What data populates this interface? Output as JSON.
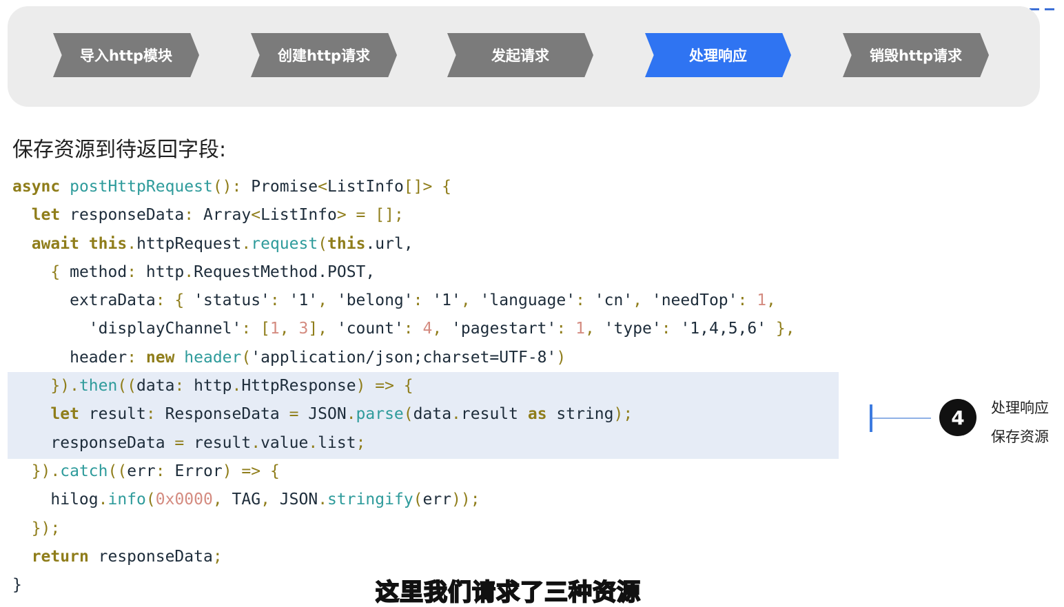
{
  "steps": [
    {
      "label": "导入http模块",
      "active": false
    },
    {
      "label": "创建http请求",
      "active": false
    },
    {
      "label": "发起请求",
      "active": false
    },
    {
      "label": "处理响应",
      "active": true
    },
    {
      "label": "销毁http请求",
      "active": false
    }
  ],
  "section_title": "保存资源到待返回字段:",
  "code": {
    "line1": {
      "kw": "async",
      "fn": "postHttpRequest",
      "a": "(): ",
      "b": "Promise",
      "c": "<",
      "d": "ListInfo",
      "e": "[]> {"
    },
    "line2": {
      "kw": "let",
      "a": " responseData",
      "b": ": ",
      "c": "Array",
      "d": "<",
      "e": "ListInfo",
      "f": "> = [];"
    },
    "line3": {
      "kw1": "await",
      "kw2": "this",
      "a": ".",
      "b": "httpRequest",
      "c": ".",
      "fn": "request",
      "d": "(",
      "kw3": "this",
      "e": ".url,"
    },
    "line4": {
      "a": "{ ",
      "b": "method",
      "c": ": ",
      "d": "http",
      "e": ".",
      "f": "RequestMethod",
      "g": ".POST,"
    },
    "line5": {
      "a": "extraData",
      "b": ": { ",
      "c": "'status'",
      "d": ": ",
      "e": "'1'",
      "f": ", ",
      "g": "'belong'",
      "h": ": ",
      "i": "'1'",
      "j": ", ",
      "k": "'language'",
      "l": ": ",
      "m": "'cn'",
      "n": ", ",
      "o": "'needTop'",
      "p": ": ",
      "q": "1",
      "r": ","
    },
    "line6": {
      "a": "'displayChannel'",
      "b": ": [",
      "c": "1",
      "d": ", ",
      "e": "3",
      "f": "], ",
      "g": "'count'",
      "h": ": ",
      "i": "4",
      "j": ", ",
      "k": "'pagestart'",
      "l": ": ",
      "m": "1",
      "n": ", ",
      "o": "'type'",
      "p": ": ",
      "q": "'1,4,5,6'",
      "r": " },"
    },
    "line7": {
      "a": "header",
      "b": ": ",
      "kw": "new",
      "fn": "header",
      "c": "(",
      "d": "'application/json;charset=UTF-8'",
      "e": ")"
    },
    "line8": {
      "a": "})",
      "b": ".",
      "fn": "then",
      "c": "((",
      "d": "data",
      "e": ": ",
      "f": "http",
      "g": ".",
      "h": "HttpResponse",
      "i": ") => {"
    },
    "line9": {
      "kw": "let",
      "a": " result",
      "b": ": ",
      "c": "ResponseData",
      "d": " = ",
      "e": "JSON",
      "f": ".",
      "fn": "parse",
      "g": "(",
      "h": "data",
      "i": ".",
      "j": "result",
      "kw2": "as",
      "k": "string",
      "l": ");"
    },
    "line10": {
      "a": "responseData",
      "b": " = ",
      "c": "result",
      "d": ".",
      "e": "value",
      "f": ".",
      "g": "list",
      "h": ";"
    },
    "line11": {
      "a": "})",
      "b": ".",
      "fn": "catch",
      "c": "((",
      "d": "err",
      "e": ": ",
      "f": "Error",
      "g": ") => {"
    },
    "line12": {
      "a": "hilog",
      "b": ".",
      "fn": "info",
      "c": "(",
      "d": "0x0000",
      "e": ", ",
      "f": "TAG",
      "g": ", ",
      "h": "JSON",
      "i": ".",
      "fn2": "stringify",
      "j": "(",
      "k": "err",
      "l": "));"
    },
    "line13": {
      "a": "});"
    },
    "line14": {
      "kw": "return",
      "a": " responseData",
      "b": ";"
    },
    "line15": {
      "a": "}"
    }
  },
  "annotation": {
    "number": "4",
    "title": "处理响应",
    "subtitle": "保存资源"
  },
  "caption": "这里我们请求了三种资源",
  "colors": {
    "active_step": "#2f74f2",
    "inactive_step": "#7b7b7b",
    "highlight": "#e6ecf6",
    "keyword": "#8f7d1a",
    "function": "#2e9b9b",
    "number": "#d48b80"
  }
}
